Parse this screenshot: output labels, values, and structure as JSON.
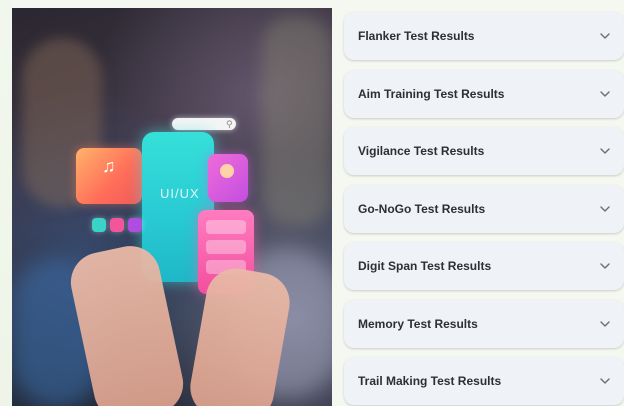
{
  "hero": {
    "phone_text": "UI/UX"
  },
  "accordion": {
    "items": [
      {
        "label": "Flanker Test Results",
        "icon": "chevron-down-icon"
      },
      {
        "label": "Aim Training Test Results",
        "icon": "chevron-down-icon"
      },
      {
        "label": "Vigilance Test Results",
        "icon": "chevron-down-icon"
      },
      {
        "label": "Go-NoGo Test Results",
        "icon": "chevron-down-icon"
      },
      {
        "label": "Digit Span Test Results",
        "icon": "chevron-down-icon"
      },
      {
        "label": "Memory Test Results",
        "icon": "chevron-down-icon"
      },
      {
        "label": "Trail Making Test Results",
        "icon": "chevron-down-icon"
      }
    ]
  },
  "colors": {
    "background": "#f5f8f0",
    "accordion_bg": "#eff2f6",
    "label_text": "#2d2f33",
    "chevron": "#6b6f75"
  }
}
